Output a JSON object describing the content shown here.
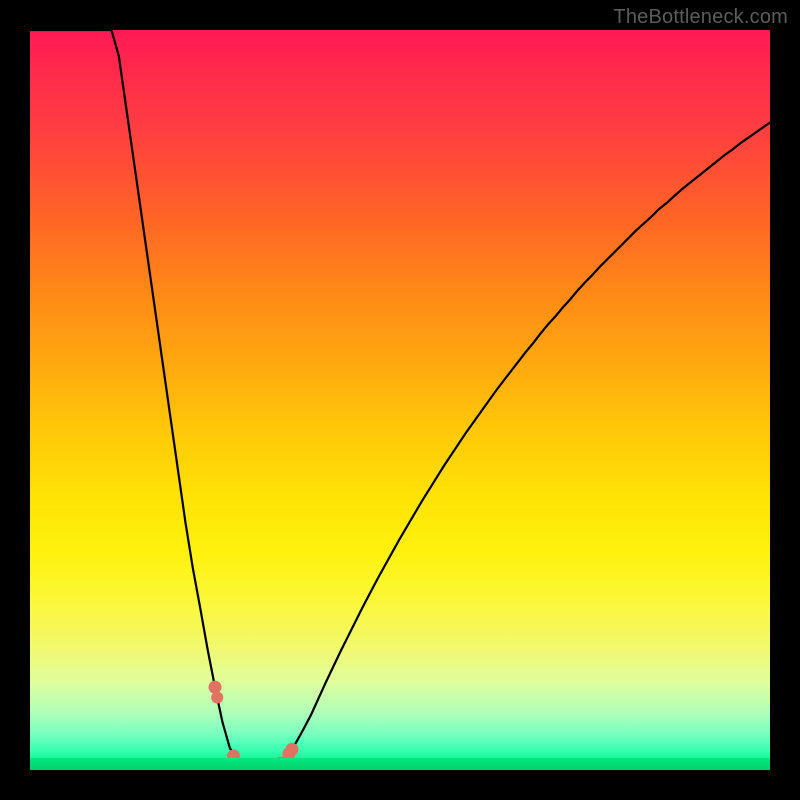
{
  "watermark": "TheBottleneck.com",
  "colors": {
    "frame": "#000000",
    "gradient_top": "#ff1a55",
    "gradient_bottom": "#09d86a",
    "curve": "#000000",
    "marker": "#e07362"
  },
  "chart_data": {
    "type": "line",
    "title": "",
    "xlabel": "",
    "ylabel": "",
    "xlim": [
      0,
      100
    ],
    "ylim": [
      0,
      100
    ],
    "grid": false,
    "legend": false,
    "x": [
      0,
      1,
      2,
      3,
      4,
      5,
      6,
      7,
      8,
      9,
      10,
      11,
      12,
      13,
      14,
      15,
      16,
      17,
      18,
      19,
      20,
      21,
      22,
      23,
      24,
      25,
      26,
      27,
      28,
      29,
      30,
      31,
      32,
      33,
      34,
      35,
      36,
      37,
      38,
      39,
      40,
      41,
      42,
      43,
      44,
      45,
      46,
      47,
      48,
      49,
      50,
      51,
      52,
      53,
      54,
      55,
      56,
      57,
      58,
      59,
      60,
      61,
      62,
      63,
      64,
      65,
      66,
      67,
      68,
      69,
      70,
      71,
      72,
      73,
      74,
      75,
      76,
      77,
      78,
      79,
      80,
      81,
      82,
      83,
      84,
      85,
      86,
      87,
      88,
      89,
      90,
      91,
      92,
      93,
      94,
      95,
      96,
      97,
      98,
      99,
      100
    ],
    "y": [
      100,
      100,
      100,
      100,
      100,
      100,
      100,
      100,
      100,
      100,
      100,
      100,
      96.5,
      89.5,
      82.5,
      75.5,
      68.5,
      61.5,
      54.5,
      47.5,
      40.5,
      33.5,
      27.3,
      21.9,
      16.3,
      11.2,
      6.5,
      3.0,
      1.2,
      0.5,
      0.3,
      0.3,
      0.4,
      0.6,
      1.2,
      2.2,
      3.8,
      5.6,
      7.5,
      9.7,
      11.9,
      14.0,
      16.1,
      18.1,
      20.1,
      22.1,
      24.0,
      25.9,
      27.7,
      29.5,
      31.3,
      33.0,
      34.7,
      36.4,
      38.0,
      39.6,
      41.2,
      42.7,
      44.2,
      45.7,
      47.1,
      48.5,
      49.9,
      51.3,
      52.6,
      53.9,
      55.2,
      56.5,
      57.7,
      59.0,
      60.2,
      61.3,
      62.5,
      63.6,
      64.8,
      65.9,
      66.9,
      68.0,
      69.0,
      70.0,
      71.0,
      72.0,
      73.0,
      73.9,
      74.8,
      75.8,
      76.6,
      77.5,
      78.4,
      79.2,
      80.0,
      80.8,
      81.6,
      82.4,
      83.2,
      83.9,
      84.7,
      85.4,
      86.1,
      86.8,
      87.5
    ],
    "markers": {
      "x": [
        25.0,
        25.3,
        27.5,
        29.0,
        30.0,
        31.2,
        32.5,
        33.8,
        35.0,
        35.4
      ],
      "y": [
        11.2,
        9.8,
        1.9,
        0.6,
        0.4,
        0.4,
        0.5,
        1.0,
        2.2,
        2.8
      ],
      "r": [
        6.0,
        5.5,
        6.0,
        5.5,
        6.0,
        5.5,
        6.0,
        5.5,
        6.0,
        6.0
      ]
    }
  }
}
